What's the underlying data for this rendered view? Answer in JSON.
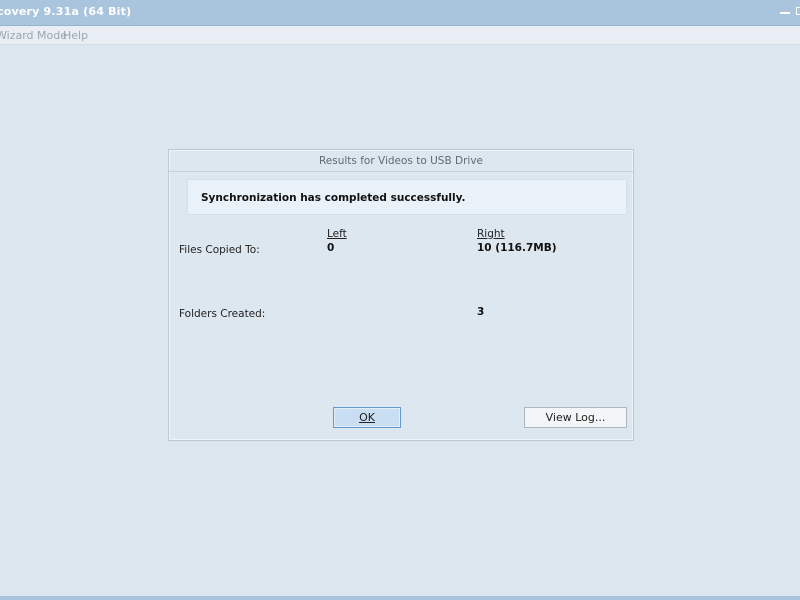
{
  "window": {
    "title": "covery 9.31a (64 Bit)"
  },
  "menu": {
    "items": [
      "Wizard Mode",
      "Help"
    ]
  },
  "dialog": {
    "title": "Results for Videos to USB Drive",
    "message": "Synchronization has completed successfully.",
    "columns": {
      "left": "Left",
      "right": "Right"
    },
    "rows": [
      {
        "label": "Files Copied To:",
        "left": "0",
        "right": "10 (116.7MB)"
      },
      {
        "label": "Folders Created:",
        "left": "",
        "right": "3"
      }
    ],
    "buttons": {
      "ok": "OK",
      "view_log": "View Log..."
    }
  },
  "colors": {
    "titlebar": "#a9c5de",
    "background": "#dce6ee",
    "ok_button": "#c9def3"
  }
}
